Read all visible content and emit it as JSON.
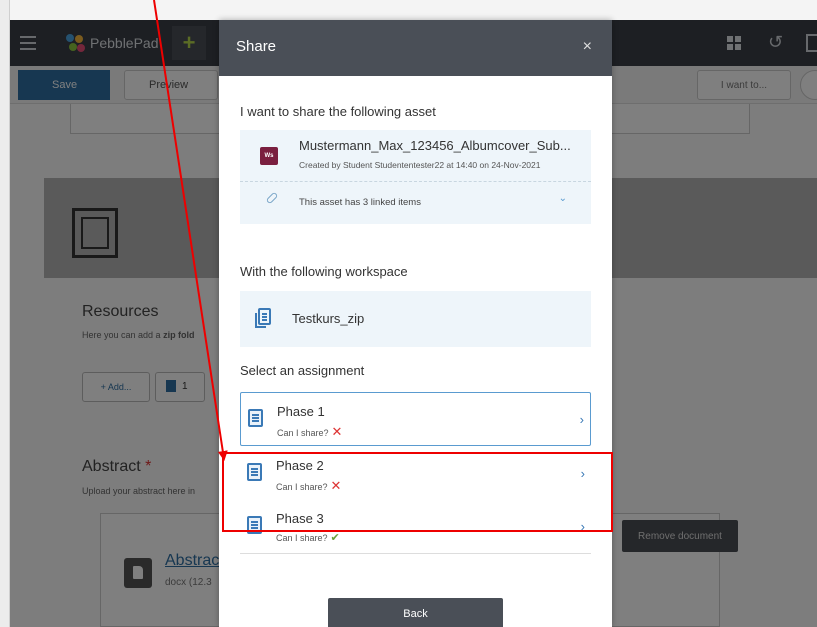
{
  "app": {
    "logo_text": "PebblePad",
    "toolbar": {
      "save_label": "Save",
      "preview_label": "Preview",
      "iwant_label": "I want to..."
    }
  },
  "background": {
    "resources_title": "Resources",
    "resources_desc_prefix": "Here you can add a ",
    "resources_desc_bold": "zip fold",
    "add_label": "+ Add...",
    "file_count": "1",
    "abstract_title": "Abstract",
    "abstract_required": "*",
    "abstract_desc": "Upload your abstract here in",
    "abstract_link": "Abstrac",
    "abstract_meta": "docx (12.3",
    "remove_label": "Remove document"
  },
  "modal": {
    "title": "Share",
    "close": "×",
    "asset_label": "I want to share the following asset",
    "asset": {
      "icon_text": "Ws",
      "name": "Mustermann_Max_123456_Albumcover_Sub...",
      "meta": "Created by Student Studententester22 at 14:40 on 24-Nov-2021",
      "linked": "This asset has 3 linked items"
    },
    "workspace_label": "With the following workspace",
    "workspace_name": "Testkurs_zip",
    "assignment_label": "Select an assignment",
    "assignments": [
      {
        "title": "Phase 1",
        "subtitle": "Can I share?",
        "status": "✕"
      },
      {
        "title": "Phase 2",
        "subtitle": "Can I share?",
        "status": "✕"
      },
      {
        "title": "Phase 3",
        "subtitle": "Can I share?",
        "status": "✔"
      }
    ],
    "back_label": "Back"
  },
  "colors": {
    "header": "#4a4f57",
    "accent_blue": "#3a79b6",
    "highlight_red": "#e00000",
    "cross_red": "#dd3333",
    "check_green": "#6ba13a"
  }
}
